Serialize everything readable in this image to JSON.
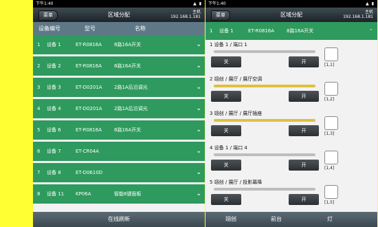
{
  "left_screen": {
    "status": {
      "time": "下午1:40",
      "icons": "▲ ▮"
    },
    "topbar": {
      "menu_label": "菜单",
      "title": "区域分配",
      "host_label": "主机",
      "host_ip": "192.168.1.181"
    },
    "columns": [
      "设备编号",
      "型号",
      "名称"
    ],
    "rows": [
      {
        "num": "1",
        "device": "设备 1",
        "model": "ET-R0816A",
        "name": "8路16A开关"
      },
      {
        "num": "2",
        "device": "设备 2",
        "model": "ET-R0816A",
        "name": "8路16A开关"
      },
      {
        "num": "3",
        "device": "设备 3",
        "model": "ET-D0201A",
        "name": "2路1A后沿调光"
      },
      {
        "num": "4",
        "device": "设备 4",
        "model": "ET-D0201A",
        "name": "2路1A后沿调光"
      },
      {
        "num": "5",
        "device": "设备 6",
        "model": "ET-R0816A",
        "name": "8路16A开关"
      },
      {
        "num": "6",
        "device": "设备 7",
        "model": "ET-CR04A",
        "name": ""
      },
      {
        "num": "7",
        "device": "设备 8",
        "model": "ET-D0610D",
        "name": ""
      },
      {
        "num": "8",
        "device": "设备 11",
        "model": "KP06A",
        "name": "智能6键面板"
      }
    ],
    "chevron": "⌄",
    "refresh_label": "在线刷新"
  },
  "right_screen": {
    "status": {
      "time": "下午1:40",
      "icons": "▲ ▮"
    },
    "topbar": {
      "menu_label": "菜单",
      "title": "区域分配",
      "host_label": "主机",
      "host_ip": "192.168.1.181"
    },
    "group": {
      "num": "1",
      "device": "设备 1",
      "model": "ET-R0816A",
      "name": "8路16A开关",
      "chevron": "⌃"
    },
    "channels": [
      {
        "title": "1   设备 1 / 端口 1",
        "track_color": "#bdbdbd",
        "off": "关",
        "on": "开",
        "pos": "[1,1]"
      },
      {
        "title": "2   翊创 / 展厅 / 展厅空调",
        "track_color": "#e0c040",
        "off": "关",
        "on": "开",
        "pos": "[1,2]"
      },
      {
        "title": "3   翊创 / 展厅 / 展厅插座",
        "track_color": "#e0c040",
        "off": "关",
        "on": "开",
        "pos": "[1,3]"
      },
      {
        "title": "4   设备 1 / 端口 4",
        "track_color": "#bdbdbd",
        "off": "关",
        "on": "开",
        "pos": "[1,4]"
      },
      {
        "title": "5   翊创 / 展厅 / 投影幕降",
        "track_color": "#bdbdbd",
        "off": "关",
        "on": "开",
        "pos": "[1,5]"
      }
    ],
    "tabs": [
      "翊创",
      "前台",
      "灯"
    ]
  }
}
